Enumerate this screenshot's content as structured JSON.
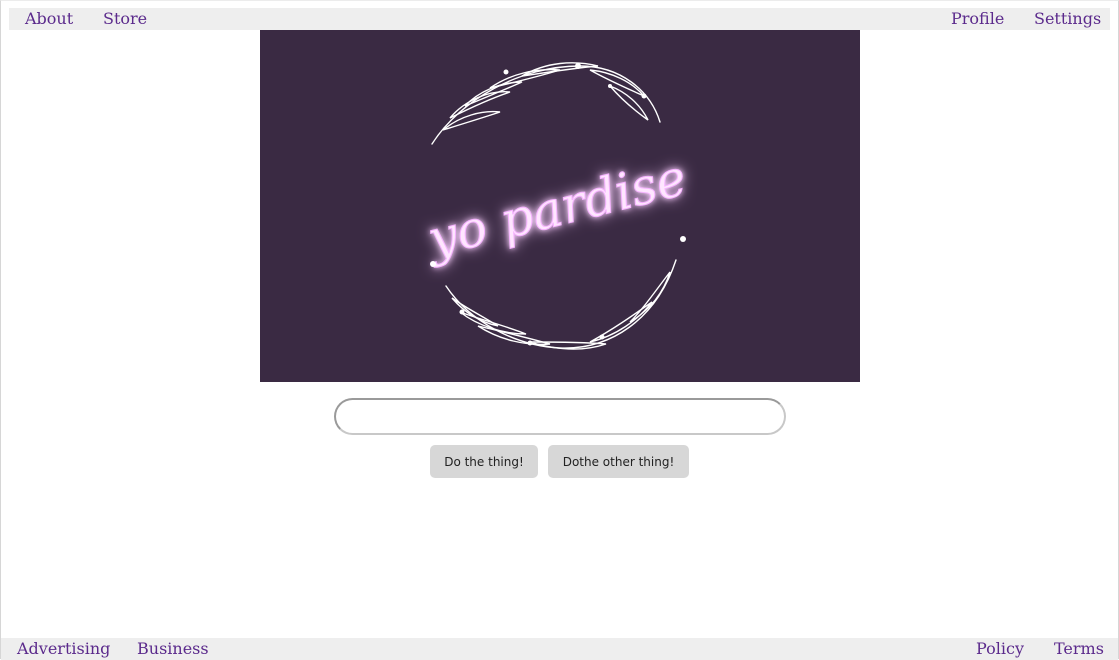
{
  "topnav": {
    "left": [
      "About",
      "Store"
    ],
    "right": [
      "Profile",
      "Settings"
    ]
  },
  "hero": {
    "logo_text": "yo pardise",
    "background": "#3a2a43",
    "neon_color": "#f6b3ff"
  },
  "search": {
    "value": "",
    "placeholder": ""
  },
  "buttons": {
    "primary": "Do the thing!",
    "secondary": "Dothe other thing!"
  },
  "footer": {
    "left": [
      "Advertising",
      "Business"
    ],
    "right": [
      "Policy",
      "Terms"
    ]
  },
  "colors": {
    "link": "#5b2a8c",
    "bar": "#eeeeee",
    "button": "#d7d7d7"
  }
}
